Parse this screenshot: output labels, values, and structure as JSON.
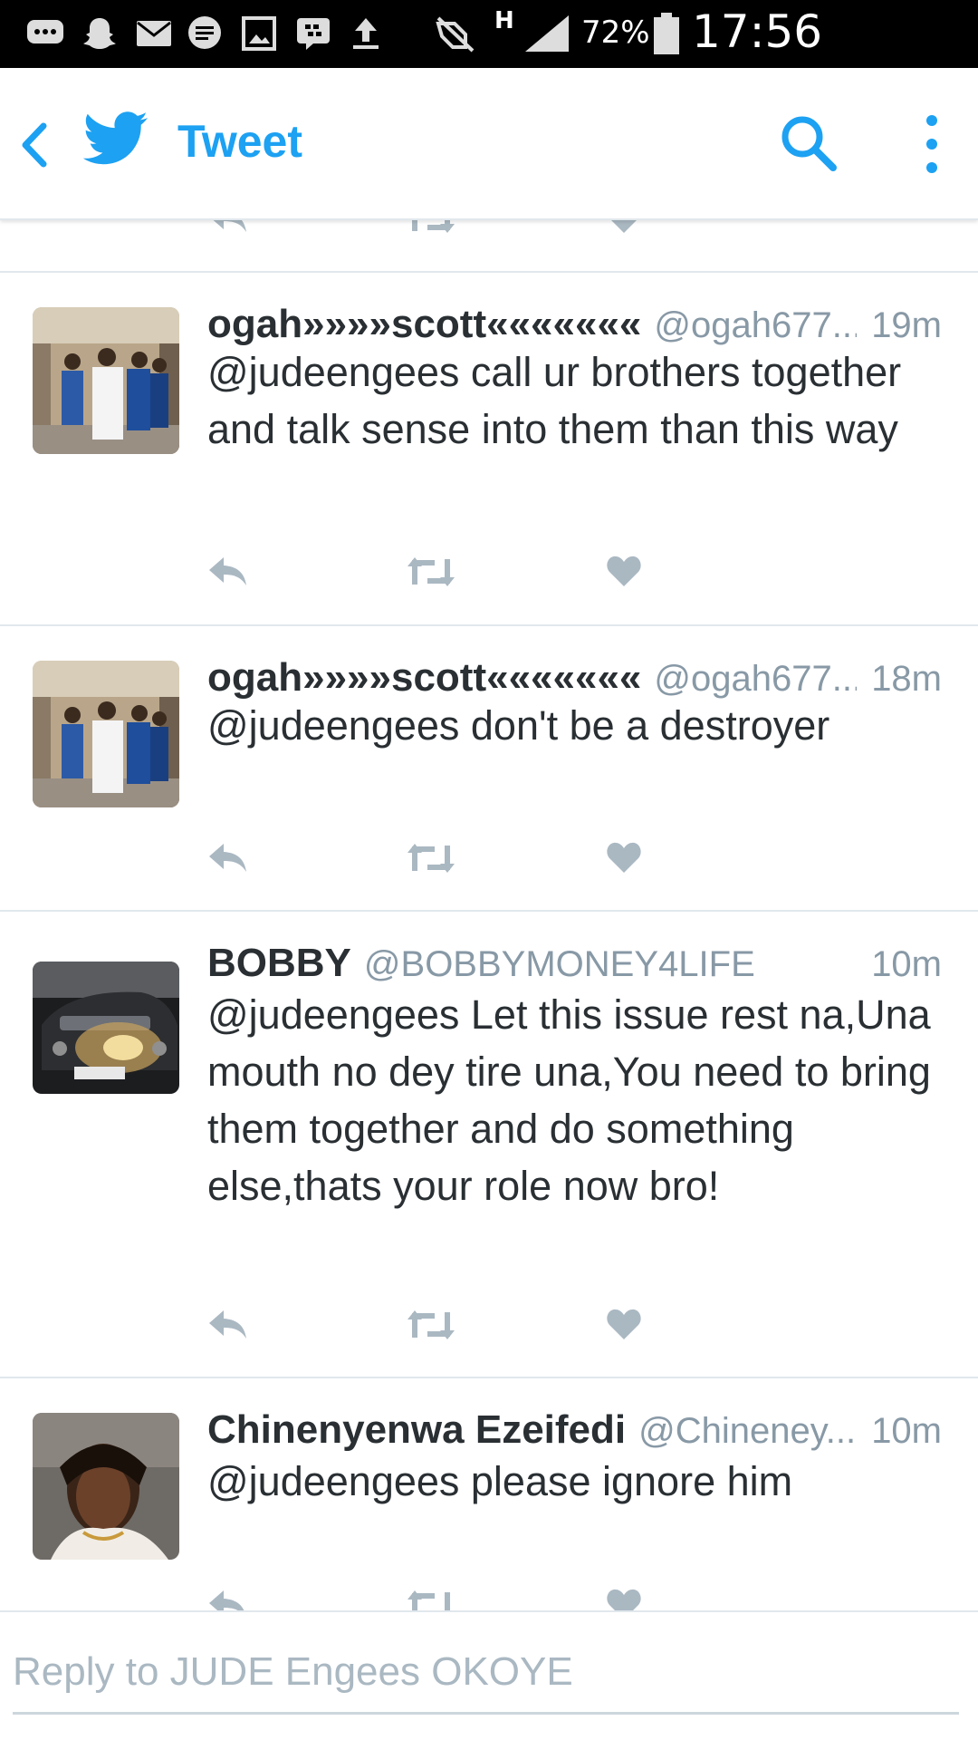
{
  "status_bar": {
    "battery": "72%",
    "time": "17:56",
    "network": "H",
    "icons": [
      "chat-bubble-icon",
      "snapchat-icon",
      "mail-icon",
      "message-icon",
      "gallery-icon",
      "bbm-icon",
      "upload-icon",
      "mute-icon",
      "signal-icon",
      "battery-icon"
    ]
  },
  "header": {
    "title": "Tweet",
    "accent_color": "#1da1f2"
  },
  "tweets": [
    {
      "name": "ogah»»»»scott«««««««",
      "handle": "@ogah677...",
      "time": "19m",
      "text": "@judeengees  call ur brothers together and talk sense into them than this way"
    },
    {
      "name": "ogah»»»»scott«««««««",
      "handle": "@ogah677...",
      "time": "18m",
      "text": "@judeengees  don't be a destroyer"
    },
    {
      "name": "BOBBY",
      "handle": "@BOBBYMONEY4LIFE",
      "time": "10m",
      "text": "@judeengees  Let this issue rest na,Una mouth no dey tire una,You need to bring them together and do something else,thats your role now bro!"
    },
    {
      "name": "Chinenyenwa Ezeifedi",
      "handle": "@Chineney...",
      "time": "10m",
      "text": "@judeengees please ignore him"
    }
  ],
  "reply": {
    "placeholder": "Reply to JUDE Engees OKOYE"
  },
  "colors": {
    "icon_gray": "#aab8c2",
    "divider": "#e1e8ed",
    "muted_text": "#8899a6"
  }
}
